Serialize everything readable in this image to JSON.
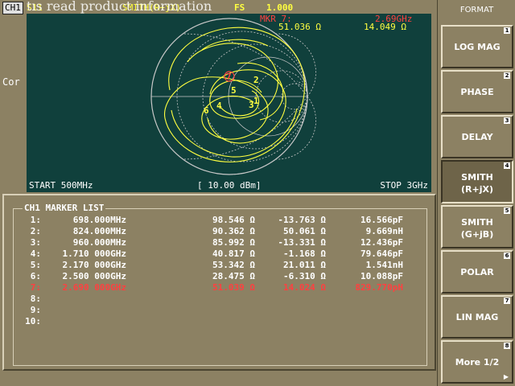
{
  "header": {
    "channel": "CH1",
    "measurement": "S11",
    "overlay_text": "tıs read product information",
    "format": "SMITH(R+jX)",
    "fs_label": "FS",
    "fs_value": "1.000"
  },
  "side_label": "Cor",
  "active_marker": {
    "label": "MKR  7:",
    "freq": "2.69GHz",
    "resistance": "51.036 Ω",
    "reactance": "14.049 Ω"
  },
  "plot_footer": {
    "start": "START 500MHz",
    "power": "[ 10.00 dBm]",
    "stop": "STOP 3GHz"
  },
  "marker_list": {
    "title": "CH1 MARKER LIST",
    "rows": [
      {
        "num": "1:",
        "freq": "698.000MHz",
        "re": "98.546 Ω",
        "im": "-13.763 Ω",
        "eq": "16.566pF",
        "red": false
      },
      {
        "num": "2:",
        "freq": "824.000MHz",
        "re": "90.362 Ω",
        "im": "50.061 Ω",
        "eq": "9.669nH",
        "red": false
      },
      {
        "num": "3:",
        "freq": "960.000MHz",
        "re": "85.992 Ω",
        "im": "-13.331 Ω",
        "eq": "12.436pF",
        "red": false
      },
      {
        "num": "4:",
        "freq": "1.710 000GHz",
        "re": "40.817 Ω",
        "im": "-1.168 Ω",
        "eq": "79.646pF",
        "red": false
      },
      {
        "num": "5:",
        "freq": "2.170 000GHz",
        "re": "53.342 Ω",
        "im": "21.011 Ω",
        "eq": "1.541nH",
        "red": false
      },
      {
        "num": "6:",
        "freq": "2.500 000GHz",
        "re": "28.475 Ω",
        "im": "-6.310 Ω",
        "eq": "10.088pF",
        "red": false
      },
      {
        "num": "7:",
        "freq": "2.690 000GHz",
        "re": "51.039 Ω",
        "im": "14.024 Ω",
        "eq": "829.770pH",
        "red": true
      },
      {
        "num": "8:",
        "freq": "",
        "re": "",
        "im": "",
        "eq": "",
        "red": false
      },
      {
        "num": "9:",
        "freq": "",
        "re": "",
        "im": "",
        "eq": "",
        "red": false
      },
      {
        "num": "10:",
        "freq": "",
        "re": "",
        "im": "",
        "eq": "",
        "red": false
      }
    ]
  },
  "softkeys": {
    "title": "FORMAT",
    "items": [
      {
        "label": "LOG MAG",
        "label2": "",
        "num": "1",
        "active": false
      },
      {
        "label": "PHASE",
        "label2": "",
        "num": "2",
        "active": false
      },
      {
        "label": "DELAY",
        "label2": "",
        "num": "3",
        "active": false
      },
      {
        "label": "SMITH",
        "label2": "(R+jX)",
        "num": "4",
        "active": true
      },
      {
        "label": "SMITH",
        "label2": "(G+jB)",
        "num": "5",
        "active": false
      },
      {
        "label": "POLAR",
        "label2": "",
        "num": "6",
        "active": false
      },
      {
        "label": "LIN MAG",
        "label2": "",
        "num": "7",
        "active": false
      },
      {
        "label": "More 1/2",
        "label2": "",
        "num": "8",
        "active": false,
        "arrow": "▶"
      }
    ]
  },
  "smith_markers": [
    "1",
    "2",
    "3",
    "4",
    "5",
    "6",
    "7"
  ],
  "colors": {
    "background": "#8c8163",
    "plot_bg": "#10403c",
    "trace": "#ffff40",
    "grid": "#c8c8c8",
    "active_marker": "#ff4040"
  }
}
